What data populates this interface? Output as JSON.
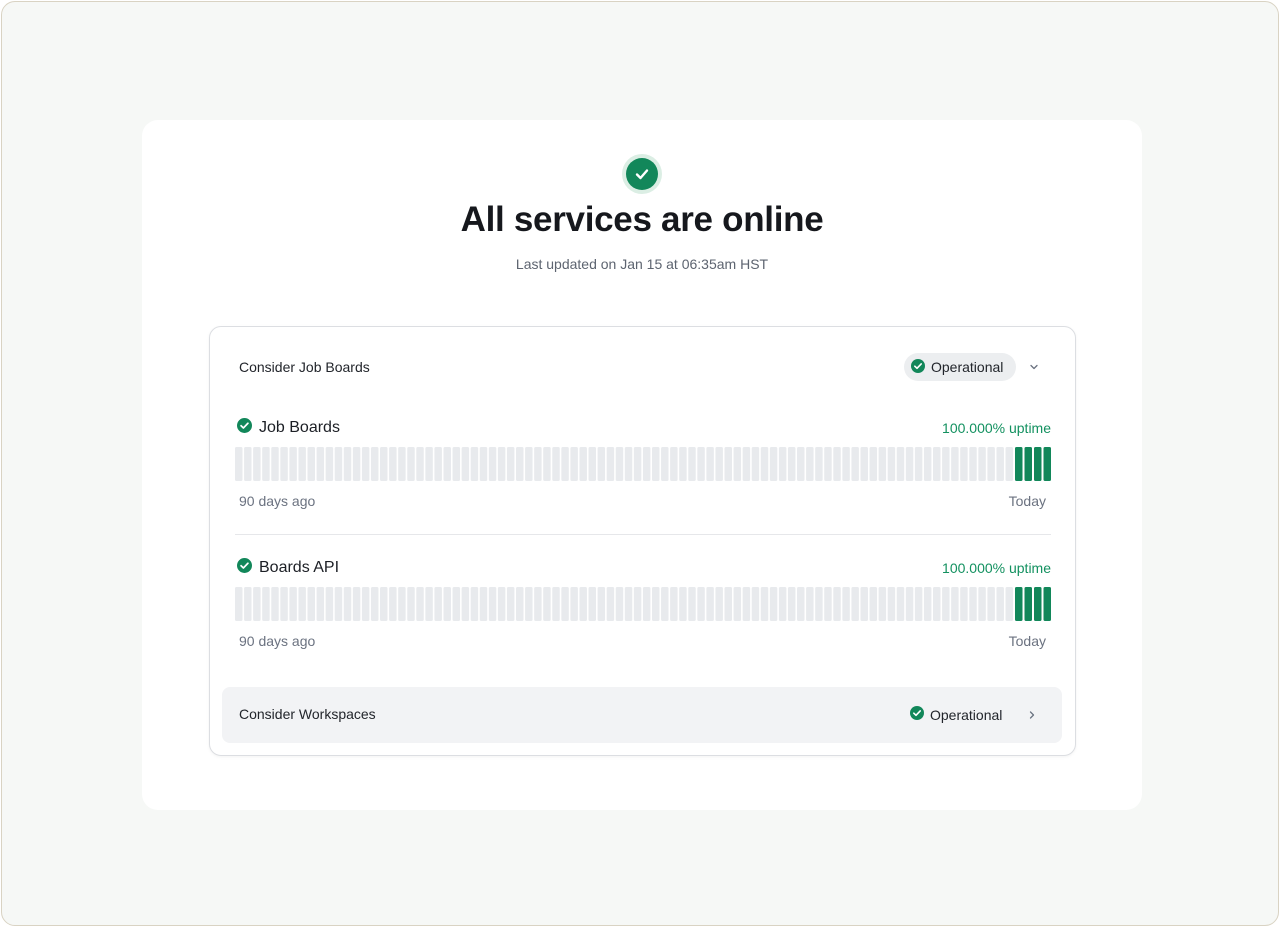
{
  "hero": {
    "icon": "check-circle-icon",
    "title": "All services are online",
    "subtitle": "Last updated on Jan 15 at 06:35am HST"
  },
  "colors": {
    "operational": "#12875a",
    "uptime_text": "#139160",
    "no_data": "#e8eaed"
  },
  "groups": [
    {
      "name": "Consider Job Boards",
      "status": "Operational",
      "expanded": true,
      "toggle_icon": "chevron-down-icon",
      "services": [
        {
          "name": "Job Boards",
          "uptime": "100.000% uptime",
          "start_label": "90 days ago",
          "end_label": "Today",
          "bar_count": 90,
          "operational_days": 4
        },
        {
          "name": "Boards API",
          "uptime": "100.000% uptime",
          "start_label": "90 days ago",
          "end_label": "Today",
          "bar_count": 90,
          "operational_days": 4
        }
      ]
    },
    {
      "name": "Consider Workspaces",
      "status": "Operational",
      "expanded": false,
      "toggle_icon": "chevron-right-icon"
    }
  ]
}
